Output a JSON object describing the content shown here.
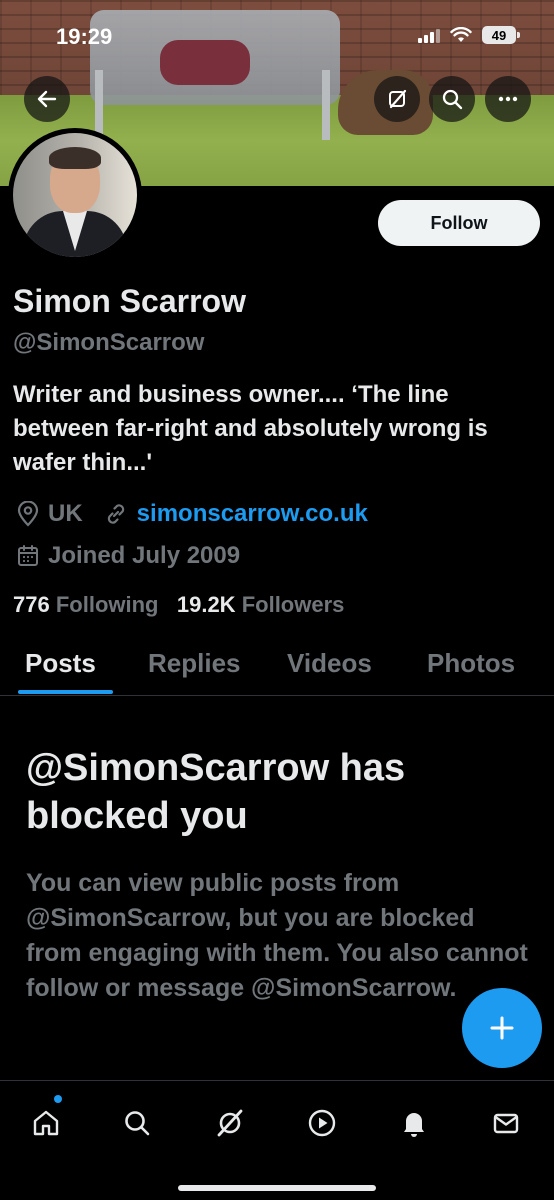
{
  "status_bar": {
    "time": "19:29",
    "battery": "49"
  },
  "profile": {
    "name": "Simon Scarrow",
    "handle": "@SimonScarrow",
    "bio": "Writer and business owner.... ‘The line between far-right and absolutely wrong is wafer thin...'",
    "location": "UK",
    "website": "simonscarrow.co.uk",
    "joined": "Joined July 2009",
    "following_count": "776",
    "following_label": "Following",
    "followers_count": "19.2K",
    "followers_label": "Followers"
  },
  "actions": {
    "follow_label": "Follow"
  },
  "tabs": [
    {
      "label": "Posts",
      "active": true
    },
    {
      "label": "Replies",
      "active": false
    },
    {
      "label": "Videos",
      "active": false
    },
    {
      "label": "Photos",
      "active": false
    }
  ],
  "blocked": {
    "title": "@SimonScarrow has blocked you",
    "description": "You can view public posts from @SimonScarrow, but you are blocked from engaging with them. You also cannot follow or message @SimonScarrow."
  },
  "icons": {
    "back": "back-arrow-icon",
    "grok": "grok-icon",
    "search": "search-icon",
    "more": "more-icon",
    "location": "location-pin-icon",
    "link": "link-icon",
    "calendar": "calendar-icon",
    "compose": "plus-icon",
    "home": "home-icon",
    "explore": "search-icon",
    "grok_nav": "grok-icon",
    "video": "play-icon",
    "notifications": "bell-icon",
    "messages": "mail-icon"
  },
  "colors": {
    "accent": "#1d9bf0",
    "background": "#000000",
    "text": "#e7e9ea",
    "muted": "#71767b"
  }
}
